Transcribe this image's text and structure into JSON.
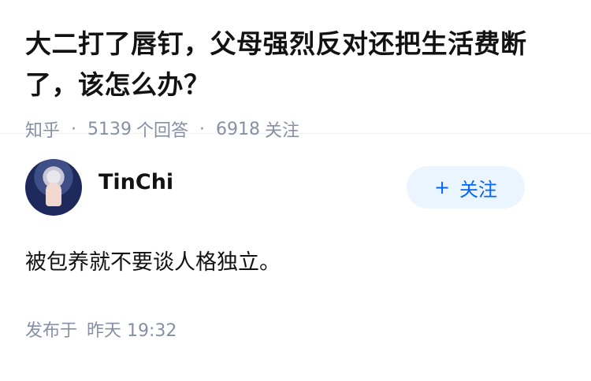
{
  "question": {
    "title": "大二打了唇钉，父母强烈反对还把生活费断了，该怎么办？",
    "source": "知乎",
    "answer_count": "5139",
    "answer_label": "个回答",
    "follow_count": "6918",
    "follow_label": "关注"
  },
  "answer": {
    "author_name": "TinChi",
    "follow_button": "关注",
    "follow_icon": "+",
    "content": "被包养就不要谈人格独立。",
    "published_label": "发布于",
    "published_time": "昨天 19:32"
  },
  "colors": {
    "primary_text": "#121212",
    "meta_text": "#8590a6",
    "accent": "#0066ff",
    "follow_bg": "#ebf5ff"
  }
}
